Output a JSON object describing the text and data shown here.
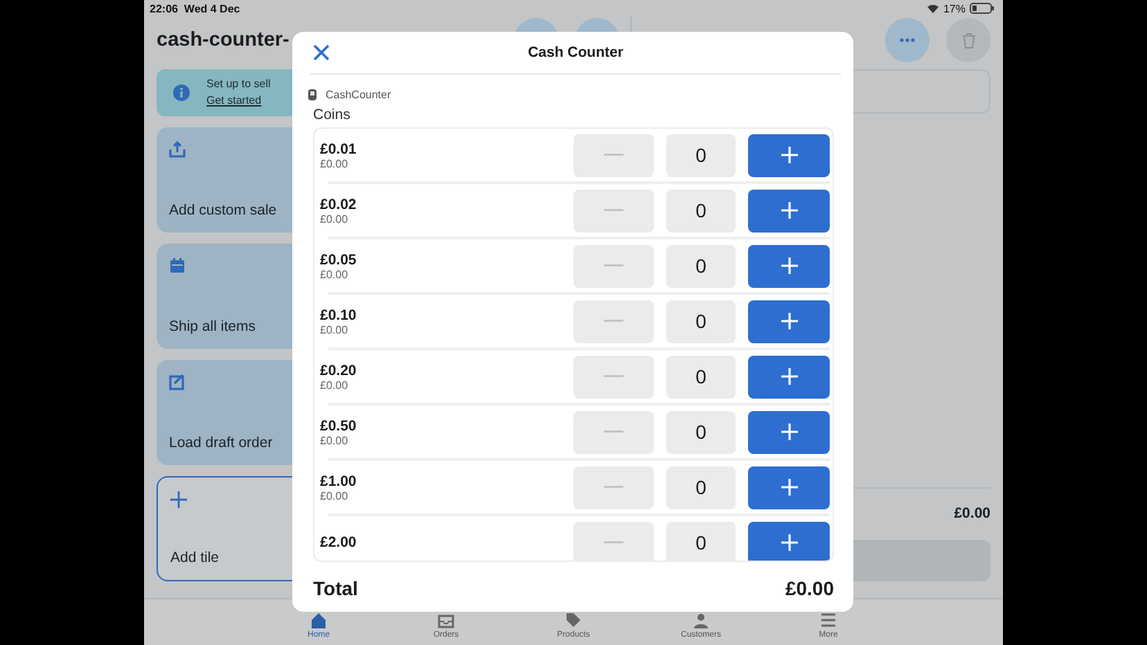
{
  "status_bar": {
    "time": "22:06",
    "date": "Wed 4 Dec",
    "battery": "17%"
  },
  "app": {
    "title": "cash-counter-",
    "banner": {
      "title": "Set up to sell",
      "link": "Get started"
    },
    "tiles": [
      {
        "label": "Add custom sale",
        "kind": "upload"
      },
      {
        "label": "Ship all items",
        "kind": "calendar"
      },
      {
        "label": "Load draft order",
        "kind": "edit"
      },
      {
        "label": "Add tile",
        "kind": "add"
      }
    ],
    "cart": {
      "subtotal": "£0.00"
    },
    "tab_bar": [
      {
        "label": "Home",
        "selected": true
      },
      {
        "label": "Orders",
        "selected": false
      },
      {
        "label": "Products",
        "selected": false
      },
      {
        "label": "Customers",
        "selected": false
      },
      {
        "label": "More",
        "selected": false
      }
    ]
  },
  "modal": {
    "title": "Cash Counter",
    "source": "CashCounter",
    "section": "Coins",
    "rows": [
      {
        "denomination": "£0.01",
        "subtotal": "£0.00",
        "count": "0",
        "minus_disabled": true
      },
      {
        "denomination": "£0.02",
        "subtotal": "£0.00",
        "count": "0",
        "minus_disabled": true
      },
      {
        "denomination": "£0.05",
        "subtotal": "£0.00",
        "count": "0",
        "minus_disabled": true
      },
      {
        "denomination": "£0.10",
        "subtotal": "£0.00",
        "count": "0",
        "minus_disabled": true
      },
      {
        "denomination": "£0.20",
        "subtotal": "£0.00",
        "count": "0",
        "minus_disabled": true
      },
      {
        "denomination": "£0.50",
        "subtotal": "£0.00",
        "count": "0",
        "minus_disabled": true
      },
      {
        "denomination": "£1.00",
        "subtotal": "£0.00",
        "count": "0",
        "minus_disabled": true
      },
      {
        "denomination": "£2.00",
        "count": "0",
        "minus_disabled": true
      }
    ],
    "total_label": "Total",
    "total": "£0.00"
  }
}
